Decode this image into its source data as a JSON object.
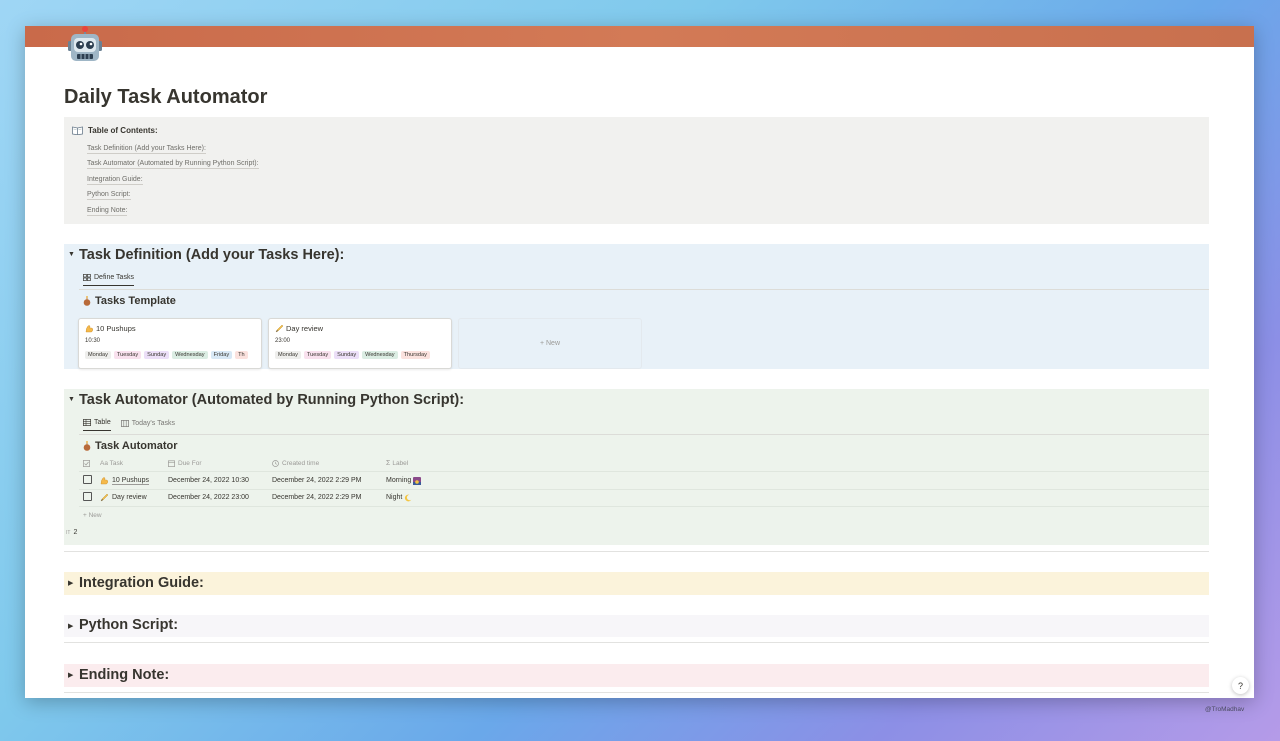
{
  "page": {
    "title": "Daily Task Automator",
    "icon": "robot-icon",
    "cover_color": "#cd7350"
  },
  "toc": {
    "heading": "Table of Contents:",
    "items": [
      "Task Definition (Add your Tasks Here):",
      "Task Automator (Automated by Running Python Script):",
      "Integration Guide:",
      "Python Script:",
      "Ending Note:"
    ]
  },
  "task_definition": {
    "title": "Task Definition (Add your Tasks Here):",
    "tab_label": "Define Tasks",
    "db_title": "Tasks Template",
    "cards": [
      {
        "title": "10 Pushups",
        "time": "10:30",
        "tags": [
          "Monday",
          "Tuesday",
          "Sunday",
          "Wednesday",
          "Friday",
          "Th"
        ]
      },
      {
        "title": "Day review",
        "time": "23:00",
        "tags": [
          "Monday",
          "Tuesday",
          "Sunday",
          "Wednesday",
          "Thursday"
        ]
      }
    ],
    "new_label": "+ New"
  },
  "task_automator": {
    "title": "Task Automator (Automated by Running Python Script):",
    "tabs": [
      "Table",
      "Today's Tasks"
    ],
    "db_title": "Task Automator",
    "columns": [
      "Aa Task",
      "Due For",
      "Created time",
      "Label"
    ],
    "rows": [
      {
        "task": "10 Pushups",
        "due": "December 24, 2022 10:30",
        "created": "December 24, 2022 2:29 PM",
        "label": "Morning"
      },
      {
        "task": "Day review",
        "due": "December 24, 2022 23:00",
        "created": "December 24, 2022 2:29 PM",
        "label": "Night"
      }
    ],
    "new_label": "New",
    "count_prefix": "IT",
    "count": "2"
  },
  "sections": {
    "integration": "Integration Guide:",
    "python": "Python Script:",
    "ending": "Ending Note:"
  },
  "help_label": "?",
  "watermark": "@TroMadhav"
}
